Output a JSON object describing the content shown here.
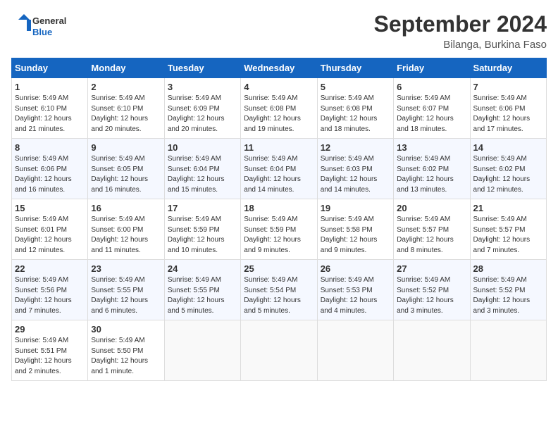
{
  "header": {
    "logo_line1": "General",
    "logo_line2": "Blue",
    "month": "September 2024",
    "location": "Bilanga, Burkina Faso"
  },
  "weekdays": [
    "Sunday",
    "Monday",
    "Tuesday",
    "Wednesday",
    "Thursday",
    "Friday",
    "Saturday"
  ],
  "weeks": [
    [
      {
        "day": "1",
        "lines": [
          "Sunrise: 5:49 AM",
          "Sunset: 6:10 PM",
          "Daylight: 12 hours",
          "and 21 minutes."
        ]
      },
      {
        "day": "2",
        "lines": [
          "Sunrise: 5:49 AM",
          "Sunset: 6:10 PM",
          "Daylight: 12 hours",
          "and 20 minutes."
        ]
      },
      {
        "day": "3",
        "lines": [
          "Sunrise: 5:49 AM",
          "Sunset: 6:09 PM",
          "Daylight: 12 hours",
          "and 20 minutes."
        ]
      },
      {
        "day": "4",
        "lines": [
          "Sunrise: 5:49 AM",
          "Sunset: 6:08 PM",
          "Daylight: 12 hours",
          "and 19 minutes."
        ]
      },
      {
        "day": "5",
        "lines": [
          "Sunrise: 5:49 AM",
          "Sunset: 6:08 PM",
          "Daylight: 12 hours",
          "and 18 minutes."
        ]
      },
      {
        "day": "6",
        "lines": [
          "Sunrise: 5:49 AM",
          "Sunset: 6:07 PM",
          "Daylight: 12 hours",
          "and 18 minutes."
        ]
      },
      {
        "day": "7",
        "lines": [
          "Sunrise: 5:49 AM",
          "Sunset: 6:06 PM",
          "Daylight: 12 hours",
          "and 17 minutes."
        ]
      }
    ],
    [
      {
        "day": "8",
        "lines": [
          "Sunrise: 5:49 AM",
          "Sunset: 6:06 PM",
          "Daylight: 12 hours",
          "and 16 minutes."
        ]
      },
      {
        "day": "9",
        "lines": [
          "Sunrise: 5:49 AM",
          "Sunset: 6:05 PM",
          "Daylight: 12 hours",
          "and 16 minutes."
        ]
      },
      {
        "day": "10",
        "lines": [
          "Sunrise: 5:49 AM",
          "Sunset: 6:04 PM",
          "Daylight: 12 hours",
          "and 15 minutes."
        ]
      },
      {
        "day": "11",
        "lines": [
          "Sunrise: 5:49 AM",
          "Sunset: 6:04 PM",
          "Daylight: 12 hours",
          "and 14 minutes."
        ]
      },
      {
        "day": "12",
        "lines": [
          "Sunrise: 5:49 AM",
          "Sunset: 6:03 PM",
          "Daylight: 12 hours",
          "and 14 minutes."
        ]
      },
      {
        "day": "13",
        "lines": [
          "Sunrise: 5:49 AM",
          "Sunset: 6:02 PM",
          "Daylight: 12 hours",
          "and 13 minutes."
        ]
      },
      {
        "day": "14",
        "lines": [
          "Sunrise: 5:49 AM",
          "Sunset: 6:02 PM",
          "Daylight: 12 hours",
          "and 12 minutes."
        ]
      }
    ],
    [
      {
        "day": "15",
        "lines": [
          "Sunrise: 5:49 AM",
          "Sunset: 6:01 PM",
          "Daylight: 12 hours",
          "and 12 minutes."
        ]
      },
      {
        "day": "16",
        "lines": [
          "Sunrise: 5:49 AM",
          "Sunset: 6:00 PM",
          "Daylight: 12 hours",
          "and 11 minutes."
        ]
      },
      {
        "day": "17",
        "lines": [
          "Sunrise: 5:49 AM",
          "Sunset: 5:59 PM",
          "Daylight: 12 hours",
          "and 10 minutes."
        ]
      },
      {
        "day": "18",
        "lines": [
          "Sunrise: 5:49 AM",
          "Sunset: 5:59 PM",
          "Daylight: 12 hours",
          "and 9 minutes."
        ]
      },
      {
        "day": "19",
        "lines": [
          "Sunrise: 5:49 AM",
          "Sunset: 5:58 PM",
          "Daylight: 12 hours",
          "and 9 minutes."
        ]
      },
      {
        "day": "20",
        "lines": [
          "Sunrise: 5:49 AM",
          "Sunset: 5:57 PM",
          "Daylight: 12 hours",
          "and 8 minutes."
        ]
      },
      {
        "day": "21",
        "lines": [
          "Sunrise: 5:49 AM",
          "Sunset: 5:57 PM",
          "Daylight: 12 hours",
          "and 7 minutes."
        ]
      }
    ],
    [
      {
        "day": "22",
        "lines": [
          "Sunrise: 5:49 AM",
          "Sunset: 5:56 PM",
          "Daylight: 12 hours",
          "and 7 minutes."
        ]
      },
      {
        "day": "23",
        "lines": [
          "Sunrise: 5:49 AM",
          "Sunset: 5:55 PM",
          "Daylight: 12 hours",
          "and 6 minutes."
        ]
      },
      {
        "day": "24",
        "lines": [
          "Sunrise: 5:49 AM",
          "Sunset: 5:55 PM",
          "Daylight: 12 hours",
          "and 5 minutes."
        ]
      },
      {
        "day": "25",
        "lines": [
          "Sunrise: 5:49 AM",
          "Sunset: 5:54 PM",
          "Daylight: 12 hours",
          "and 5 minutes."
        ]
      },
      {
        "day": "26",
        "lines": [
          "Sunrise: 5:49 AM",
          "Sunset: 5:53 PM",
          "Daylight: 12 hours",
          "and 4 minutes."
        ]
      },
      {
        "day": "27",
        "lines": [
          "Sunrise: 5:49 AM",
          "Sunset: 5:52 PM",
          "Daylight: 12 hours",
          "and 3 minutes."
        ]
      },
      {
        "day": "28",
        "lines": [
          "Sunrise: 5:49 AM",
          "Sunset: 5:52 PM",
          "Daylight: 12 hours",
          "and 3 minutes."
        ]
      }
    ],
    [
      {
        "day": "29",
        "lines": [
          "Sunrise: 5:49 AM",
          "Sunset: 5:51 PM",
          "Daylight: 12 hours",
          "and 2 minutes."
        ]
      },
      {
        "day": "30",
        "lines": [
          "Sunrise: 5:49 AM",
          "Sunset: 5:50 PM",
          "Daylight: 12 hours",
          "and 1 minute."
        ]
      },
      {
        "day": "",
        "lines": []
      },
      {
        "day": "",
        "lines": []
      },
      {
        "day": "",
        "lines": []
      },
      {
        "day": "",
        "lines": []
      },
      {
        "day": "",
        "lines": []
      }
    ]
  ]
}
